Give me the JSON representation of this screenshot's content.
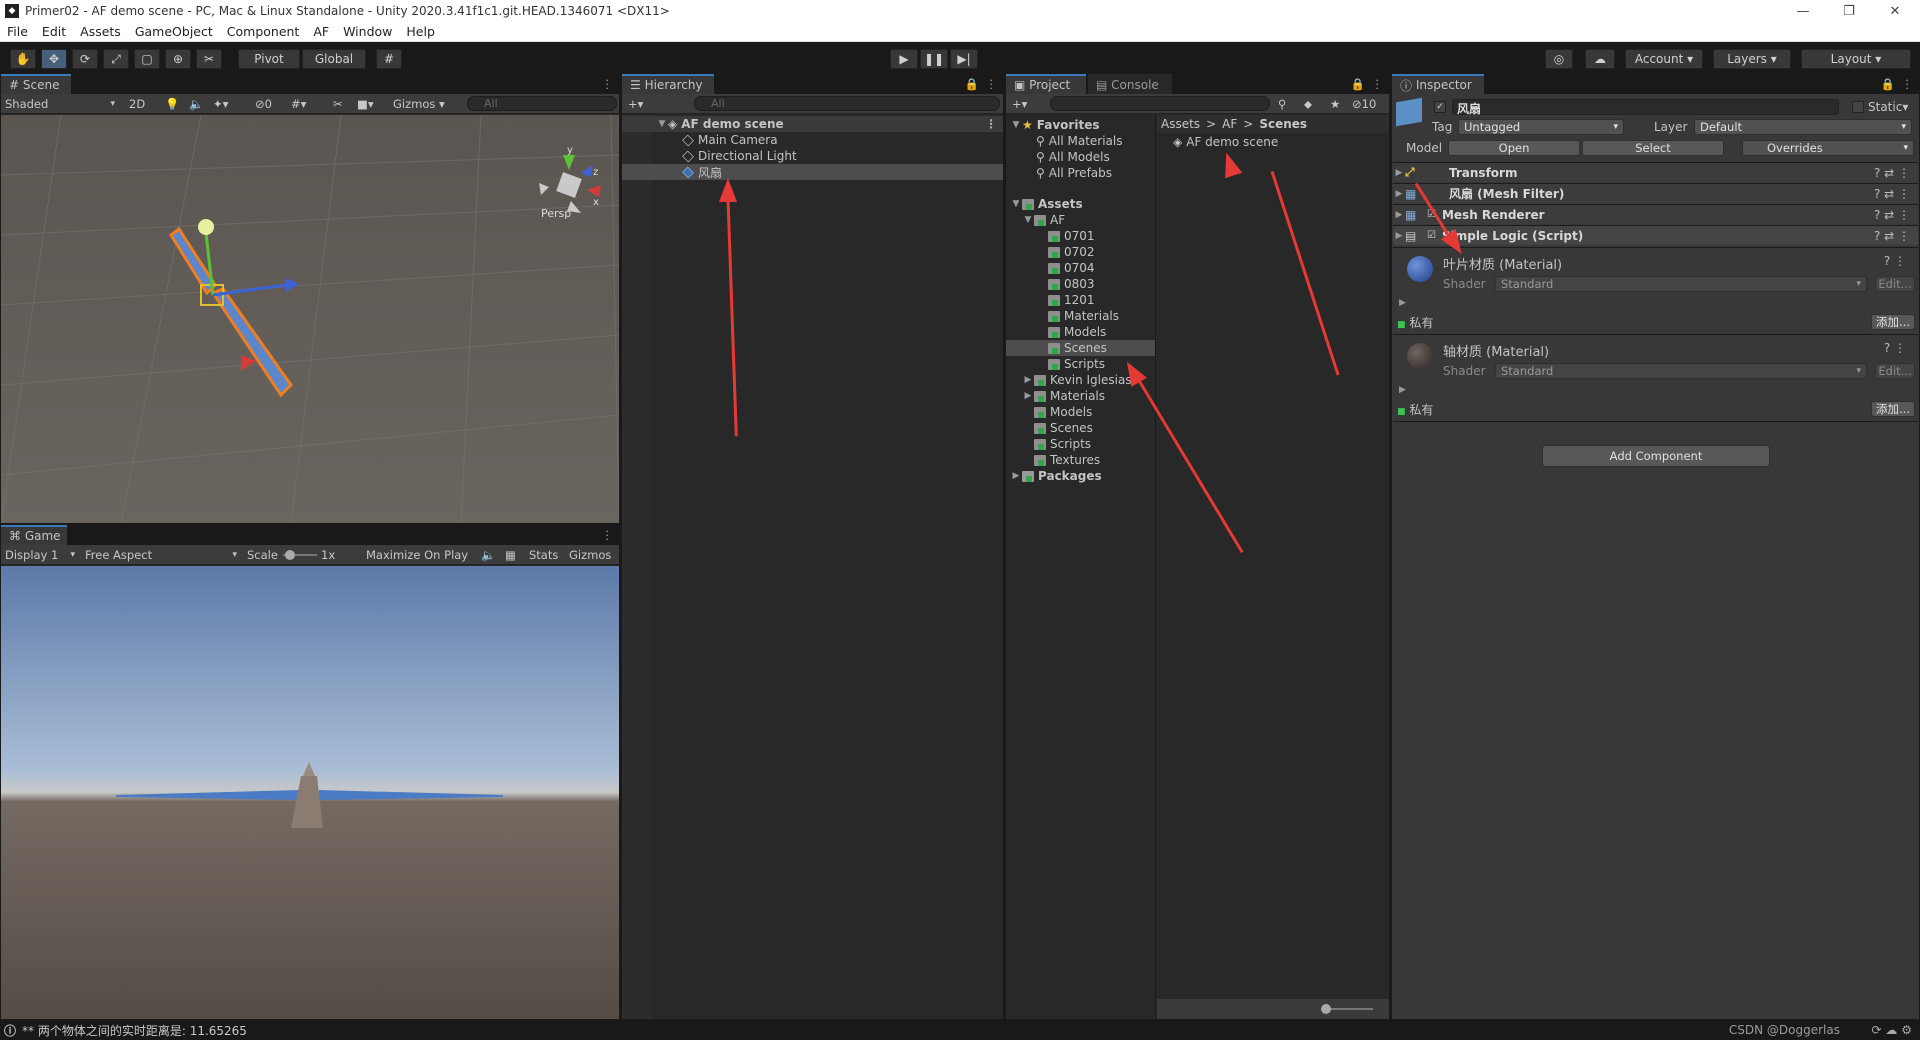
{
  "window": {
    "title": "Primer02 - AF demo scene - PC, Mac & Linux Standalone - Unity 2020.3.41f1c1.git.HEAD.1346071 <DX11>"
  },
  "menu": [
    "File",
    "Edit",
    "Assets",
    "GameObject",
    "Component",
    "AF",
    "Window",
    "Help"
  ],
  "toolbar": {
    "pivot": "Pivot",
    "global": "Global",
    "account": "Account",
    "layers": "Layers",
    "layout": "Layout"
  },
  "scene": {
    "tab": "Scene",
    "shading": "Shaded",
    "mode2d": "2D",
    "hidden_count": "0",
    "gizmos": "Gizmos",
    "search_placeholder": "All",
    "persp": "Persp",
    "axis_y": "y",
    "axis_x": "x",
    "axis_z": "z"
  },
  "game": {
    "tab": "Game",
    "display": "Display 1",
    "aspect": "Free Aspect",
    "scale_label": "Scale",
    "scale_value": "1x",
    "maximize": "Maximize On Play",
    "stats": "Stats",
    "gizmos": "Gizmos"
  },
  "hierarchy": {
    "tab": "Hierarchy",
    "search_placeholder": "All",
    "scene_name": "AF demo scene",
    "items": [
      "Main Camera",
      "Directional Light",
      "风扇"
    ]
  },
  "project": {
    "tab": "Project",
    "console_tab": "Console",
    "hidden_count": "10",
    "favorites_label": "Favorites",
    "favorites": [
      "All Materials",
      "All Models",
      "All Prefabs"
    ],
    "assets_label": "Assets",
    "af_label": "AF",
    "af_children": [
      "0701",
      "0702",
      "0704",
      "0803",
      "1201",
      "Materials",
      "Models",
      "Scenes",
      "Scripts"
    ],
    "assets_children": [
      "Kevin Iglesias",
      "Materials",
      "Models",
      "Scenes",
      "Scripts",
      "Textures"
    ],
    "packages_label": "Packages",
    "breadcrumb": [
      "Assets",
      "AF",
      "Scenes"
    ],
    "files": [
      "AF demo scene"
    ]
  },
  "inspector": {
    "tab": "Inspector",
    "object_name": "风扇",
    "static_label": "Static",
    "tag_label": "Tag",
    "tag_value": "Untagged",
    "layer_label": "Layer",
    "layer_value": "Default",
    "model_label": "Model",
    "open_btn": "Open",
    "select_btn": "Select",
    "overrides_btn": "Overrides",
    "components": [
      "Transform",
      "风扇 (Mesh Filter)",
      "Mesh Renderer",
      "Simple Logic (Script)"
    ],
    "materials": [
      {
        "name": "叶片材质 (Material)",
        "shader_label": "Shader",
        "shader": "Standard",
        "edit": "Edit...",
        "private": "私有",
        "add": "添加..."
      },
      {
        "name": "轴材质 (Material)",
        "shader_label": "Shader",
        "shader": "Standard",
        "edit": "Edit...",
        "private": "私有",
        "add": "添加..."
      }
    ],
    "add_component": "Add Component"
  },
  "status": {
    "message": "** 两个物体之间的实时距离是: 11.65265",
    "watermark": "CSDN @Doggerlas"
  },
  "colors": {
    "accent": "#3a79bb",
    "fan_blade": "#5b86c9",
    "selection_outline": "#f07d22",
    "annotation": "#e53935"
  }
}
